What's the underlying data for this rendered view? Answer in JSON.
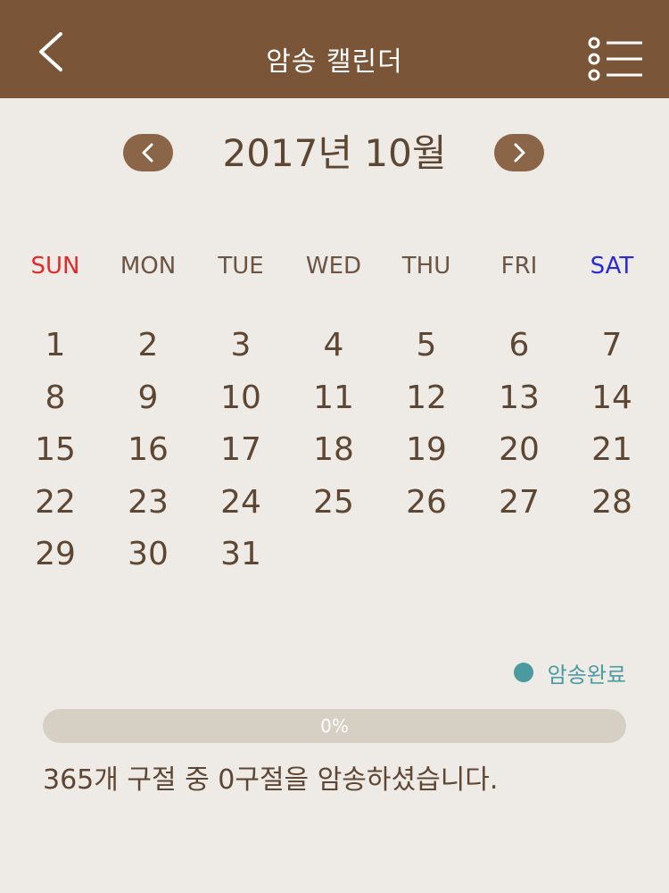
{
  "header": {
    "title": "암송 캘린더",
    "back_icon": "chevron-left-icon",
    "menu_icon": "list-menu-icon"
  },
  "calendar": {
    "month_label": "2017년 10월",
    "weekdays": [
      "SUN",
      "MON",
      "TUE",
      "WED",
      "THU",
      "FRI",
      "SAT"
    ],
    "first_weekday_index": 0,
    "days": [
      "1",
      "2",
      "3",
      "4",
      "5",
      "6",
      "7",
      "8",
      "9",
      "10",
      "11",
      "12",
      "13",
      "14",
      "15",
      "16",
      "17",
      "18",
      "19",
      "20",
      "21",
      "22",
      "23",
      "24",
      "25",
      "26",
      "27",
      "28",
      "29",
      "30",
      "31"
    ]
  },
  "legend": {
    "label": "암송완료",
    "color": "#4a9aa0"
  },
  "progress": {
    "value": 0,
    "label": "0%"
  },
  "summary": "365개 구절 중 0구절을 암송하셨습니다.",
  "colors": {
    "header_bg": "#7a5538",
    "background": "#eeebe6",
    "text": "#5d4632",
    "sunday": "#e22a2a",
    "saturday": "#2a2ad8",
    "accent": "#4a9aa0"
  }
}
